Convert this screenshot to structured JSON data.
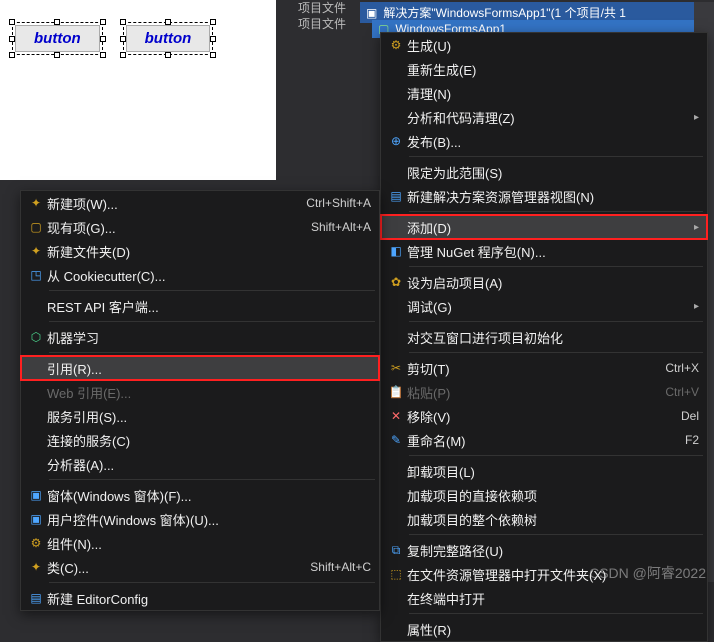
{
  "designer": {
    "button1": "button",
    "button2": "button"
  },
  "top": {
    "l1": "项目文件",
    "l2": "项目文件"
  },
  "solution": {
    "text": "解决方案\"WindowsFormsApp1\"(1 个项目/共 1",
    "project": "WindowsFormsApp1"
  },
  "rmenu": {
    "build": "生成(U)",
    "rebuild": "重新生成(E)",
    "clean": "清理(N)",
    "analyze": "分析和代码清理(Z)",
    "publish": "发布(B)...",
    "scope": "限定为此范围(S)",
    "newview": "新建解决方案资源管理器视图(N)",
    "add": "添加(D)",
    "nuget": "管理 NuGet 程序包(N)...",
    "startup": "设为启动项目(A)",
    "debug": "调试(G)",
    "init": "对交互窗口进行项目初始化",
    "cut": "剪切(T)",
    "cut_sc": "Ctrl+X",
    "paste": "粘贴(P)",
    "paste_sc": "Ctrl+V",
    "remove": "移除(V)",
    "remove_sc": "Del",
    "rename": "重命名(M)",
    "rename_sc": "F2",
    "unload": "卸载项目(L)",
    "dep1": "加载项目的直接依赖项",
    "dep2": "加载项目的整个依赖树",
    "copypath": "复制完整路径(U)",
    "explorer": "在文件资源管理器中打开文件夹(X)",
    "terminal": "在终端中打开",
    "props": "属性(R)"
  },
  "lmenu": {
    "newitem": "新建项(W)...",
    "newitem_sc": "Ctrl+Shift+A",
    "existing": "现有项(G)...",
    "existing_sc": "Shift+Alt+A",
    "newfolder": "新建文件夹(D)",
    "cookie": "从 Cookiecutter(C)...",
    "rest": "REST API 客户端...",
    "ml": "机器学习",
    "ref": "引用(R)...",
    "webref": "Web 引用(E)...",
    "svcref": "服务引用(S)...",
    "connsvc": "连接的服务(C)",
    "analyzer": "分析器(A)...",
    "form": "窗体(Windows 窗体)(F)...",
    "uc": "用户控件(Windows 窗体)(U)...",
    "comp": "组件(N)...",
    "class": "类(C)...",
    "class_sc": "Shift+Alt+C",
    "editorconfig": "新建 EditorConfig"
  },
  "watermark": "CSDN @阿睿2022"
}
